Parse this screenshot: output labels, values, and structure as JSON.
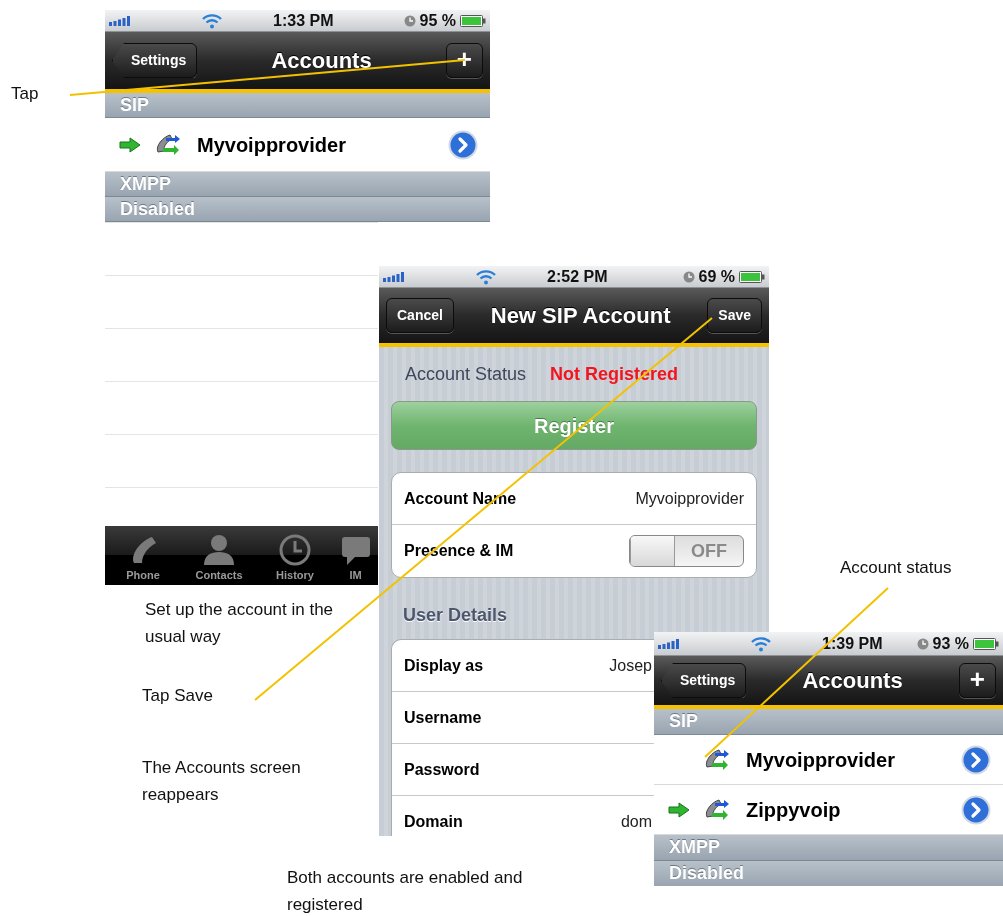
{
  "annotations": [
    {
      "text": "Tap"
    },
    {
      "text": "Set up the account in the usual way"
    },
    {
      "text": "Tap Save"
    },
    {
      "text": "The Accounts screen reappears"
    },
    {
      "text": "Both accounts are enabled and registered"
    },
    {
      "text": "Account status"
    }
  ],
  "screens": [
    {
      "kind": "accounts",
      "status_bar": {
        "time": "1:33 PM",
        "battery": "95 %"
      },
      "nav": {
        "back": "Settings",
        "title": "Accounts",
        "add": "+"
      },
      "sections": [
        {
          "title": "SIP",
          "accounts": [
            {
              "name": "Myvoipprovider",
              "active": true
            }
          ]
        },
        {
          "title": "XMPP"
        },
        {
          "title": "Disabled"
        }
      ],
      "tab_bar": [
        {
          "label": "Phone",
          "kind": "phone"
        },
        {
          "label": "Contacts",
          "kind": "contacts"
        },
        {
          "label": "History",
          "kind": "history"
        },
        {
          "label": "IM",
          "kind": "im"
        }
      ]
    },
    {
      "kind": "new_account",
      "status_bar": {
        "time": "2:52 PM",
        "battery": "69 %"
      },
      "nav": {
        "cancel": "Cancel",
        "title": "New SIP Account",
        "save": "Save"
      },
      "status_label": "Account Status",
      "status_value": "Not Registered",
      "register": "Register",
      "groups": [
        {
          "rows": [
            {
              "kind": "text",
              "label": "Account Name",
              "value": "Myvoipprovider"
            },
            {
              "kind": "toggle",
              "label": "Presence & IM",
              "on": false,
              "toggle_text": "OFF"
            }
          ]
        },
        {
          "title": "User Details",
          "rows": [
            {
              "kind": "text",
              "label": "Display as",
              "value": "Josep"
            },
            {
              "kind": "text",
              "label": "Username"
            },
            {
              "kind": "text",
              "label": "Password"
            },
            {
              "kind": "text",
              "label": "Domain",
              "value": "dom"
            }
          ]
        }
      ]
    },
    {
      "kind": "accounts",
      "status_bar": {
        "time": "1:39 PM",
        "battery": "93 %"
      },
      "nav": {
        "back": "Settings",
        "title": "Accounts",
        "add": "+"
      },
      "sections": [
        {
          "title": "SIP",
          "accounts": [
            {
              "name": "Myvoipprovider",
              "active": false
            },
            {
              "name": "Zippyvoip",
              "active": true
            }
          ]
        },
        {
          "title": "XMPP"
        },
        {
          "title": "Disabled"
        }
      ]
    }
  ]
}
